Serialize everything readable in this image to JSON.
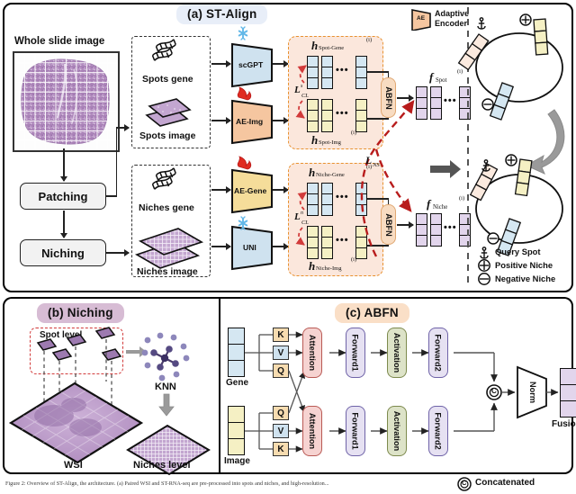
{
  "figure": {
    "caption": "Figure 2: Overview of ST-Align, the architecture. (a) Paired WSI and ST-RNA-seq are pre-processed into spots and niches, and high-resolution..."
  },
  "panels": {
    "a": {
      "title": "(a) ST-Align",
      "accent": "#e8eef8"
    },
    "b": {
      "title": "(b) Niching",
      "accent": "#d7bcd4"
    },
    "c": {
      "title": "(c) ABFN",
      "accent": "#fadfc7"
    }
  },
  "panel_a": {
    "wsi_label": "Whole slide image",
    "process_boxes": [
      {
        "label": "Patching"
      },
      {
        "label": "Niching"
      }
    ],
    "spot_group": {
      "gene_label": "Spots gene",
      "image_label": "Spots image"
    },
    "niche_group": {
      "gene_label": "Niches gene",
      "image_label": "Niches image"
    },
    "encoders": [
      {
        "name": "scGPT",
        "state": "frozen",
        "icon": "snowflake-icon",
        "color": "#cfe2ef"
      },
      {
        "name": "AE-Img",
        "state": "trainable",
        "icon": "flame-icon",
        "color": "#f5c6a0"
      },
      {
        "name": "AE-Gene",
        "state": "trainable",
        "icon": "flame-icon",
        "color": "#f5dd9a"
      },
      {
        "name": "UNI",
        "state": "frozen",
        "icon": "snowflake-icon",
        "color": "#cfe2ef"
      }
    ],
    "legend_encoder": {
      "badge": "AE",
      "line1": "Adaptive",
      "line2": "Encoder"
    },
    "features": {
      "spot_gene": {
        "h": "h",
        "sub": "Spot-Gene",
        "sup": "(i)",
        "color": "#d5e7f2"
      },
      "spot_img": {
        "h": "h",
        "sub": "Spot-Img",
        "sup": "(i)",
        "color": "#f5f0c4"
      },
      "niche_gene": {
        "h": "h",
        "sub": "Niche-Gene",
        "sup": "(i)",
        "color": "#d5e7f2"
      },
      "niche_img": {
        "h": "h",
        "sub": "Niche-Img",
        "sup": "(i)",
        "color": "#f5f0c4"
      },
      "f_spot": {
        "f": "f",
        "sub": "Spot",
        "sup": "(i)",
        "color": "#e2d5ec"
      },
      "f_niche": {
        "f": "f",
        "sub": "Niche",
        "sup": "(i)",
        "color": "#e2d5ec"
      }
    },
    "losses": [
      {
        "symbol": "L",
        "sup": "s",
        "sub": "CL",
        "name": "spot-contrastive-loss"
      },
      {
        "symbol": "L",
        "sup": "n",
        "sub": "CL",
        "name": "niche-contrastive-loss"
      },
      {
        "symbol": "L",
        "sup": "",
        "sub": "NS",
        "name": "niche-spot-loss"
      }
    ],
    "fusion_block_label": "ABFN",
    "legend_right": [
      {
        "icon": "anchor-icon",
        "label": "Query Spot"
      },
      {
        "icon": "plus-circle-icon",
        "label": "Positive Niche"
      },
      {
        "icon": "minus-circle-icon",
        "label": "Negative Niche"
      }
    ]
  },
  "panel_b": {
    "spot_level_label": "Spot level",
    "knn_label": "KNN",
    "wsi_label": "WSI",
    "niches_level_label": "Niches level"
  },
  "panel_c": {
    "rows": [
      {
        "input_label": "Gene",
        "input_color": "#d5e7f2",
        "projections": [
          {
            "label": "K",
            "color": "#f7dcb0"
          },
          {
            "label": "V",
            "color": "#cfe2ef"
          },
          {
            "label": "Q",
            "color": "#f7dcb0"
          }
        ],
        "stages": [
          {
            "label": "Attention",
            "fill": "#f6d3d1",
            "stroke": "#b95a55"
          },
          {
            "label": "Forward1",
            "fill": "#e6e1f2",
            "stroke": "#6f63a8"
          },
          {
            "label": "Activation",
            "fill": "#dde3c8",
            "stroke": "#7d8a4e"
          },
          {
            "label": "Forward2",
            "fill": "#e6e1f2",
            "stroke": "#6f63a8"
          }
        ]
      },
      {
        "input_label": "Image",
        "input_color": "#f5f0c4",
        "projections": [
          {
            "label": "Q",
            "color": "#f7dcb0"
          },
          {
            "label": "V",
            "color": "#cfe2ef"
          },
          {
            "label": "K",
            "color": "#f7dcb0"
          }
        ],
        "stages": [
          {
            "label": "Attention",
            "fill": "#f6d3d1",
            "stroke": "#b95a55"
          },
          {
            "label": "Forward1",
            "fill": "#e6e1f2",
            "stroke": "#6f63a8"
          },
          {
            "label": "Activation",
            "fill": "#dde3c8",
            "stroke": "#7d8a4e"
          },
          {
            "label": "Forward2",
            "fill": "#e6e1f2",
            "stroke": "#6f63a8"
          }
        ]
      }
    ],
    "concat_symbol": "C",
    "norm_label": "Norm",
    "fusion_label": "Fusion",
    "fusion_color": "#e2d5ec",
    "legend": {
      "symbol": "C",
      "label": "Concatenated"
    }
  },
  "colors": {
    "orange_dash": "#e8912f",
    "orange_fill": "#fbe7dc",
    "red_dash": "#d23b3b",
    "dark_red": "#b81c1c",
    "gray_arrow": "#9a9a9a",
    "tissue": "#b48fc0"
  }
}
